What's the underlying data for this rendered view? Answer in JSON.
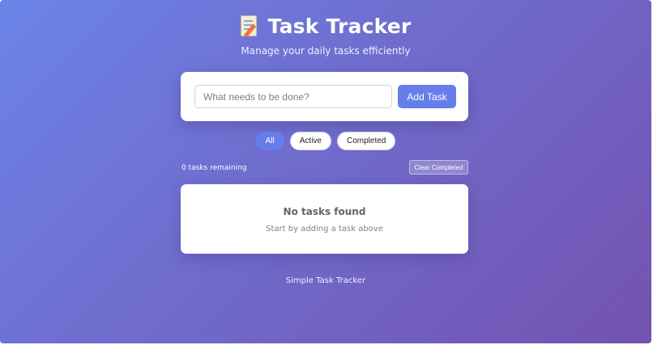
{
  "header": {
    "icon": "memo-icon",
    "title": "Task Tracker",
    "subtitle": "Manage your daily tasks efficiently"
  },
  "input": {
    "placeholder": "What needs to be done?",
    "value": "",
    "add_label": "Add Task"
  },
  "filters": {
    "items": [
      {
        "label": "All",
        "active": true
      },
      {
        "label": "Active",
        "active": false
      },
      {
        "label": "Completed",
        "active": false
      }
    ]
  },
  "status": {
    "remaining_text": "0 tasks remaining",
    "clear_label": "Clear Completed"
  },
  "list": {
    "empty_title": "No tasks found",
    "empty_hint": "Start by adding a task above"
  },
  "footer": {
    "text": "Simple Task Tracker"
  },
  "colors": {
    "accent": "#667eea",
    "gradient_start": "#6b84e8",
    "gradient_end": "#7452b0"
  }
}
